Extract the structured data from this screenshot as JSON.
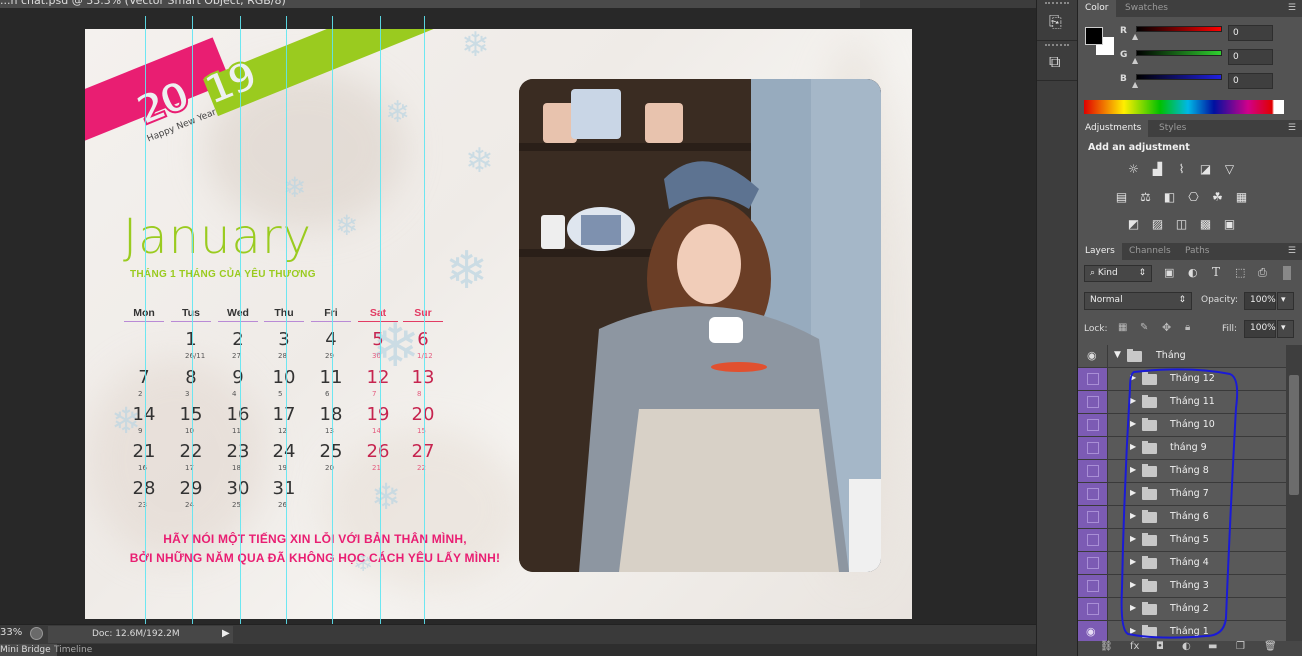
{
  "window": {
    "title": "...n chat.psd @ 33.3% (Vector Smart Object, RGB/8)"
  },
  "document": {
    "banner": {
      "year_left": "20",
      "year_right": "19",
      "greeting": "Happy New Year"
    },
    "month_title": "January",
    "subtitle": "THÁNG 1 THÁNG CỦA YÊU THƯƠNG",
    "weekdays": [
      {
        "label": "Mon",
        "weekend": false
      },
      {
        "label": "Tus",
        "weekend": false
      },
      {
        "label": "Wed",
        "weekend": false
      },
      {
        "label": "Thu",
        "weekend": false
      },
      {
        "label": "Fri",
        "weekend": false
      },
      {
        "label": "Sat",
        "weekend": true
      },
      {
        "label": "Sur",
        "weekend": true
      }
    ],
    "weeks": [
      [
        null,
        {
          "d": "1",
          "l": "26/11"
        },
        {
          "d": "2",
          "l": "27"
        },
        {
          "d": "3",
          "l": "28"
        },
        {
          "d": "4",
          "l": "29"
        },
        {
          "d": "5",
          "l": "30"
        },
        {
          "d": "6",
          "l": "1/12"
        }
      ],
      [
        {
          "d": "7",
          "l": "2"
        },
        {
          "d": "8",
          "l": "3"
        },
        {
          "d": "9",
          "l": "4"
        },
        {
          "d": "10",
          "l": "5"
        },
        {
          "d": "11",
          "l": "6"
        },
        {
          "d": "12",
          "l": "7"
        },
        {
          "d": "13",
          "l": "8"
        }
      ],
      [
        {
          "d": "14",
          "l": "9"
        },
        {
          "d": "15",
          "l": "10"
        },
        {
          "d": "16",
          "l": "11"
        },
        {
          "d": "17",
          "l": "12"
        },
        {
          "d": "18",
          "l": "13"
        },
        {
          "d": "19",
          "l": "14"
        },
        {
          "d": "20",
          "l": "15"
        }
      ],
      [
        {
          "d": "21",
          "l": "16"
        },
        {
          "d": "22",
          "l": "17"
        },
        {
          "d": "23",
          "l": "18"
        },
        {
          "d": "24",
          "l": "19"
        },
        {
          "d": "25",
          "l": "20"
        },
        {
          "d": "26",
          "l": "21"
        },
        {
          "d": "27",
          "l": "22"
        }
      ],
      [
        {
          "d": "28",
          "l": "23"
        },
        {
          "d": "29",
          "l": "24"
        },
        {
          "d": "30",
          "l": "25"
        },
        {
          "d": "31",
          "l": "26"
        },
        null,
        null,
        null
      ]
    ],
    "quote_line1": "HÃY NÓI MỘT TIẾNG XIN LỖI VỚI BẢN THÂN MÌNH,",
    "quote_line2": "BỞI NHỮNG NĂM QUA ĐÃ KHÔNG HỌC CÁCH YÊU LẤY MÌNH!",
    "photo_alt": "woman in grey poncho holding a teacup"
  },
  "statusbar": {
    "zoom": "33%",
    "doc_size": "Doc: 12.6M/192.2M"
  },
  "bottom_tabs": [
    "Mini Bridge",
    "Timeline"
  ],
  "color_panel": {
    "tabs": [
      "Color",
      "Swatches"
    ],
    "channels": [
      {
        "label": "R",
        "value": "0"
      },
      {
        "label": "G",
        "value": "0"
      },
      {
        "label": "B",
        "value": "0"
      }
    ],
    "foreground": "#000000",
    "background": "#ffffff"
  },
  "adjustments_panel": {
    "tabs": [
      "Adjustments",
      "Styles"
    ],
    "heading": "Add an adjustment",
    "icons": [
      [
        "brightness-icon",
        "levels-icon",
        "curves-icon",
        "exposure-icon",
        "vibrance-icon"
      ],
      [
        "hue-saturation-icon",
        "color-balance-icon",
        "black-white-icon",
        "photo-filter-icon",
        "channel-mixer-icon",
        "color-lookup-icon"
      ],
      [
        "invert-icon",
        "posterize-icon",
        "threshold-icon",
        "gradient-map-icon",
        "selective-color-icon"
      ]
    ]
  },
  "layers_panel": {
    "tabs": [
      "Layers",
      "Channels",
      "Paths"
    ],
    "filter_kind": "Kind",
    "blend_mode": "Normal",
    "opacity_label": "Opacity:",
    "opacity_value": "100%",
    "lock_label": "Lock:",
    "fill_label": "Fill:",
    "fill_value": "100%",
    "group_name": "Tháng",
    "layers": [
      {
        "name": "Tháng 12",
        "visible": false
      },
      {
        "name": "Tháng 11",
        "visible": false
      },
      {
        "name": "Tháng 10",
        "visible": false
      },
      {
        "name": "tháng 9",
        "visible": false
      },
      {
        "name": "Tháng 8",
        "visible": false
      },
      {
        "name": "Tháng 7",
        "visible": false
      },
      {
        "name": "Tháng 6",
        "visible": false
      },
      {
        "name": "Tháng 5",
        "visible": false
      },
      {
        "name": "Tháng 4",
        "visible": false
      },
      {
        "name": "Tháng 3",
        "visible": false
      },
      {
        "name": "Tháng 2",
        "visible": false
      },
      {
        "name": "Tháng 1",
        "visible": true
      }
    ],
    "annotation_color": "#1a1ad6"
  },
  "colors": {
    "pink": "#e91e72",
    "green": "#9acb1f",
    "guide": "#5ee6f2",
    "layer_highlight": "#7c5bb4"
  }
}
